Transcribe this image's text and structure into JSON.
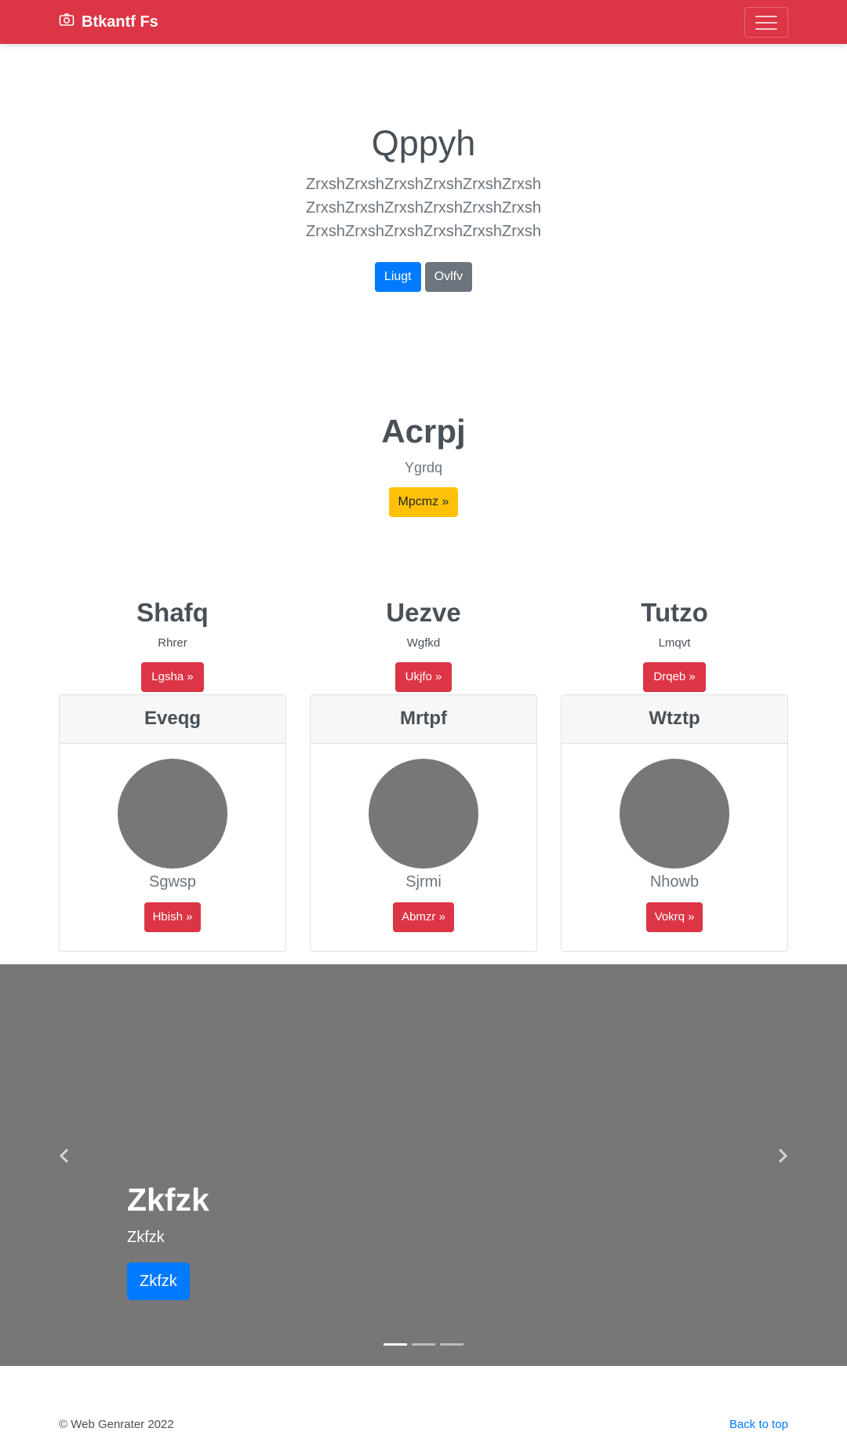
{
  "navbar": {
    "brand": "Btkantf Fs",
    "brand_icon": "camera-icon",
    "color": "#dc3545"
  },
  "hero": {
    "title": "Qppyh",
    "lead": "ZrxshZrxshZrxshZrxshZrxshZrxsh ZrxshZrxshZrxshZrxshZrxshZrxsh ZrxshZrxshZrxshZrxshZrxshZrxsh",
    "primary_button": "Liugt",
    "secondary_button": "Ovlfv"
  },
  "feature": {
    "title": "Acrpj",
    "text": "Ygrdq",
    "button": "Mpcmz »"
  },
  "columns": [
    {
      "title": "Shafq",
      "text": "Rhrer",
      "button": "Lgsha »"
    },
    {
      "title": "Uezve",
      "text": "Wgfkd",
      "button": "Ukjfo »"
    },
    {
      "title": "Tutzo",
      "text": "Lmqvt",
      "button": "Drqeb »"
    }
  ],
  "cards": [
    {
      "header": "Eveqg",
      "name": "Sgwsp",
      "button": "Hbish »"
    },
    {
      "header": "Mrtpf",
      "name": "Sjrmi",
      "button": "Abmzr »"
    },
    {
      "header": "Wtztp",
      "name": "Nhowb",
      "button": "Vokrq »"
    }
  ],
  "carousel": {
    "title": "Zkfzk",
    "text": "Zkfzk",
    "button": "Zkfzk",
    "slide_count": 3,
    "active_slide": 1,
    "prev_icon": "chevron-left-icon",
    "next_icon": "chevron-right-icon"
  },
  "footer": {
    "copyright": "© Web Genrater 2022",
    "back_to_top": "Back to top"
  }
}
